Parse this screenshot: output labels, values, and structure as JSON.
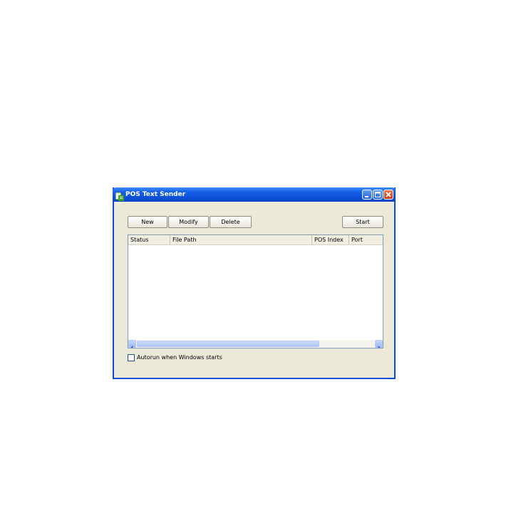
{
  "window": {
    "title": "POS Text Sender"
  },
  "toolbar": {
    "new_label": "New",
    "modify_label": "Modify",
    "delete_label": "Delete",
    "start_label": "Start"
  },
  "list": {
    "columns": [
      "Status",
      "File Path",
      "POS Index",
      "Port"
    ],
    "rows": []
  },
  "options": {
    "autorun_label": "Autorun when Windows starts",
    "autorun_checked": false
  },
  "icons": {
    "app": "app-icon",
    "minimize": "minimize-icon",
    "maximize": "maximize-icon",
    "close": "close-icon"
  },
  "colors": {
    "titlebar": "#0a4fd8",
    "window_bg": "#ece9d8",
    "close_button": "#c63b18"
  }
}
